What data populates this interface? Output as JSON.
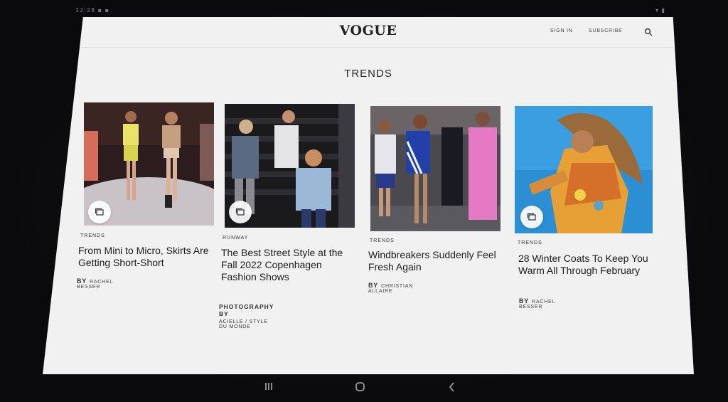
{
  "status_bar": {
    "left": "12:28 ▪ ▪",
    "right": "▾ ▮"
  },
  "header": {
    "logo": "VOGUE",
    "sign_in": "SIGN IN",
    "subscribe": "SUBSCRIBE",
    "search_icon": "search-icon"
  },
  "section": {
    "title": "TRENDS"
  },
  "cards": [
    {
      "kicker": "TRENDS",
      "headline": "From Mini to Micro, Skirts Are Getting Short-Short",
      "by": "BY",
      "author": "RACHEL BESSER"
    },
    {
      "kicker": "RUNWAY",
      "headline": "The Best Street Style at the Fall 2022 Copenhagen Fashion Shows",
      "credit_label": "PHOTOGRAPHY BY",
      "credit_value": "ACIELLE / STYLE DU MONDE"
    },
    {
      "kicker": "TRENDS",
      "headline": "Windbreakers Suddenly Feel Fresh Again",
      "by": "BY",
      "author": "CHRISTIAN ALLAIRE"
    },
    {
      "kicker": "TRENDS",
      "headline": "28 Winter Coats To Keep You Warm All Through February",
      "by": "BY",
      "author": "RACHEL BESSER"
    }
  ],
  "colors": {
    "screen_bg": "#f1f1f1",
    "text": "#1c1c1c",
    "bezel": "#0b0b0d"
  }
}
